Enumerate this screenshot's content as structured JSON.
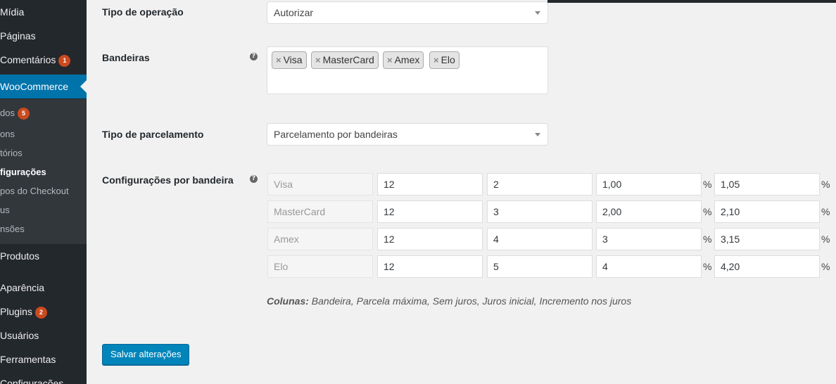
{
  "sidebar": {
    "items": [
      {
        "label": "Mídia",
        "badge": null
      },
      {
        "label": "Páginas",
        "badge": null
      },
      {
        "label": "Comentários",
        "badge": "1"
      },
      {
        "label": "WooCommerce",
        "badge": null
      },
      {
        "label": "Produtos",
        "badge": null
      },
      {
        "label": "Aparência",
        "badge": null
      },
      {
        "label": "Plugins",
        "badge": "2"
      },
      {
        "label": "Usuários",
        "badge": null
      },
      {
        "label": "Ferramentas",
        "badge": null
      },
      {
        "label": "Configurações",
        "badge": null
      }
    ],
    "submenu": [
      {
        "label": "dos",
        "badge": "5"
      },
      {
        "label": "ons",
        "badge": null
      },
      {
        "label": "tórios",
        "badge": null
      },
      {
        "label": "figurações",
        "badge": null
      },
      {
        "label": "pos do Checkout",
        "badge": null
      },
      {
        "label": "us",
        "badge": null
      },
      {
        "label": "nsões",
        "badge": null
      }
    ]
  },
  "form": {
    "operation": {
      "label": "Tipo de operação",
      "value": "Autorizar"
    },
    "brands": {
      "label": "Bandeiras",
      "tokens": [
        "Visa",
        "MasterCard",
        "Amex",
        "Elo"
      ]
    },
    "installments": {
      "label": "Tipo de parcelamento",
      "value": "Parcelamento por bandeiras"
    },
    "brand_config": {
      "label": "Configurações por bandeira",
      "percent_sign": "%",
      "rows": [
        {
          "brand": "Visa",
          "max_installments": "12",
          "interest_free": "2",
          "initial_interest": "1,00",
          "increment": "1,05"
        },
        {
          "brand": "MasterCard",
          "max_installments": "12",
          "interest_free": "3",
          "initial_interest": "2,00",
          "increment": "2,10"
        },
        {
          "brand": "Amex",
          "max_installments": "12",
          "interest_free": "4",
          "initial_interest": "3",
          "increment": "3,15"
        },
        {
          "brand": "Elo",
          "max_installments": "12",
          "interest_free": "5",
          "initial_interest": "4",
          "increment": "4,20"
        }
      ],
      "columns_label": "Colunas:",
      "columns_text": "Bandeira, Parcela máxima, Sem juros, Juros inicial, Incremento nos juros"
    },
    "save_label": "Salvar alterações"
  },
  "colors": {
    "accent": "#0073aa",
    "button": "#0085ba",
    "badge": "#ca4a1f",
    "sidebar": "#23282d"
  }
}
